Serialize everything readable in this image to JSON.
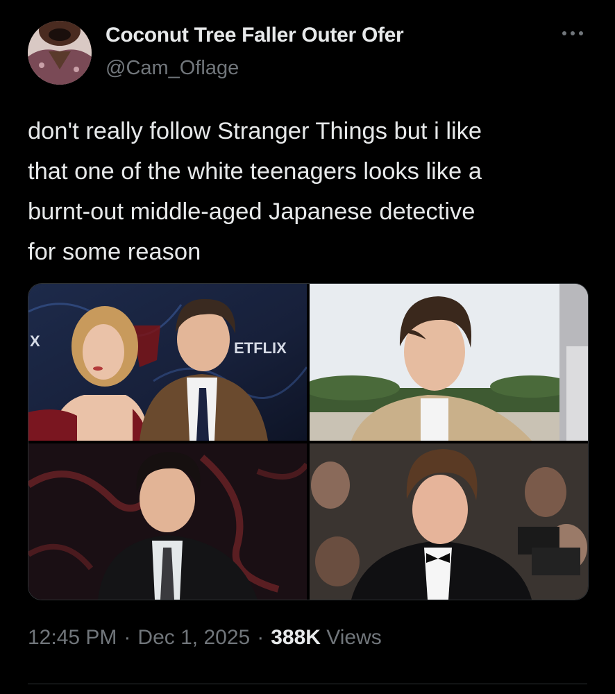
{
  "author": {
    "display_name": "Coconut Tree Faller Outer Ofer",
    "handle": "@Cam_Oflage",
    "avatar_icon": "profile-avatar-photo"
  },
  "more_icon": "ellipsis-icon",
  "tweet": {
    "text": "don't really follow Stranger Things but i like\nthat one of the white teenagers looks like a\nburnt-out middle-aged Japanese detective\nfor some reason"
  },
  "media": {
    "backdrop_text_1": "ETFLIX",
    "backdrop_text_2": "X"
  },
  "meta": {
    "time": "12:45 PM",
    "separator": "·",
    "date": "Dec 1, 2025",
    "views_count": "388K",
    "views_label": "Views"
  },
  "colors": {
    "background": "#000000",
    "primary_text": "#e7e9ea",
    "secondary_text": "#71767b",
    "border": "#2f3336"
  }
}
